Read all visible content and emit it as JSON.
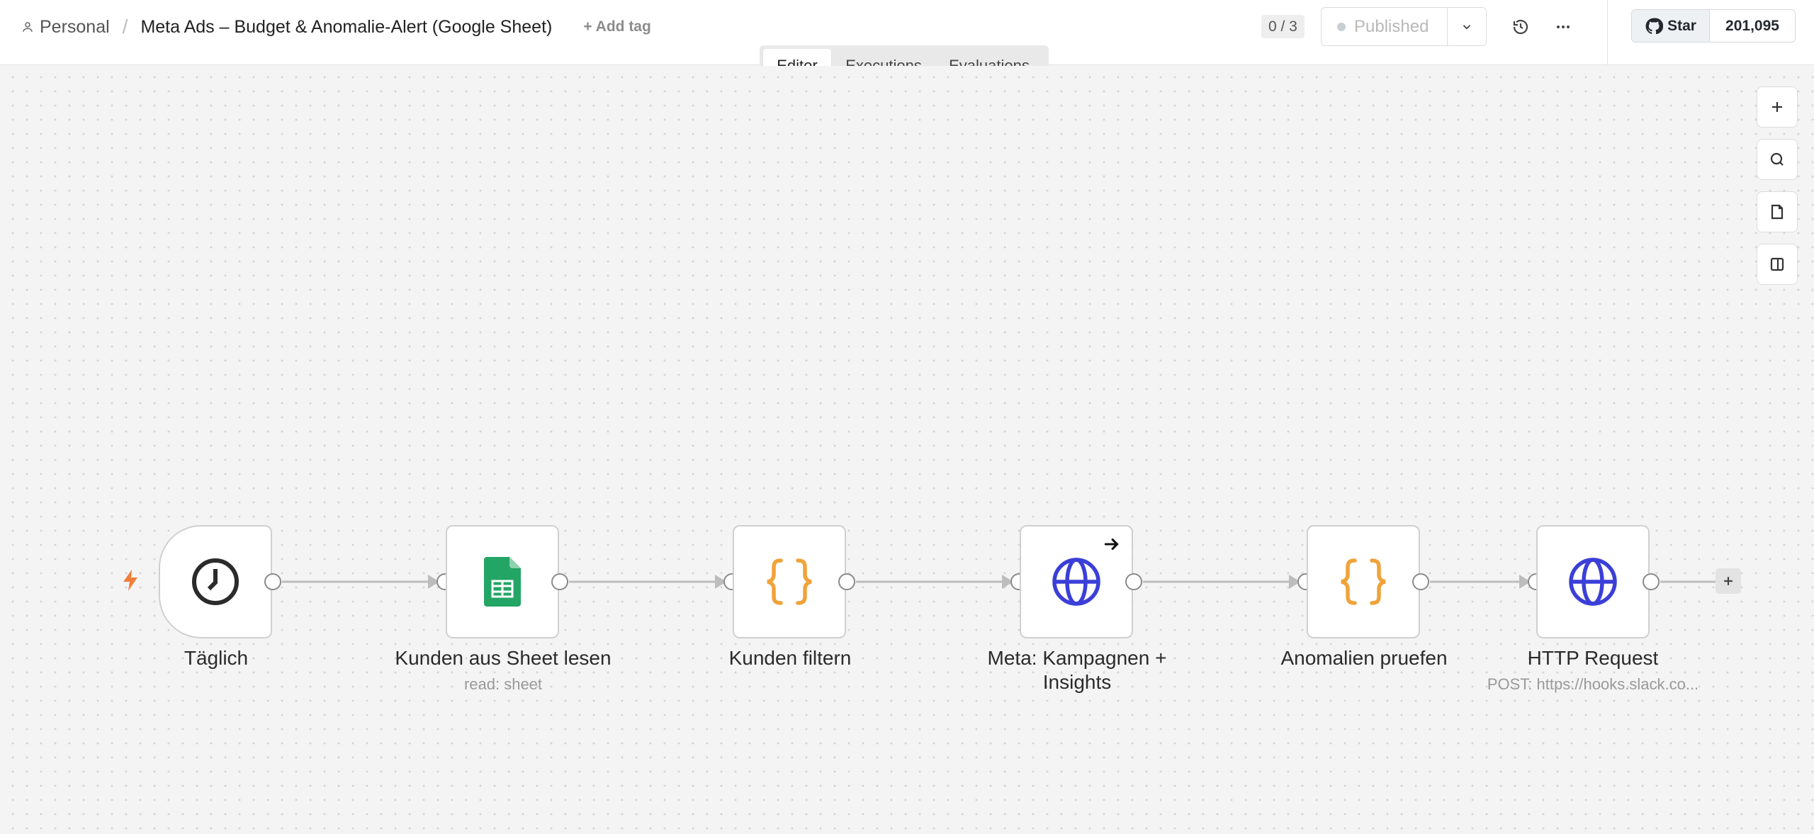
{
  "header": {
    "project": "Personal",
    "separator": "/",
    "workflow_title": "Meta Ads – Budget & Anomalie-Alert (Google Sheet)",
    "add_tag": "+ Add tag",
    "version_counter": "0 / 3",
    "publish_label": "Published",
    "github": {
      "star_label": "Star",
      "star_count": "201,095"
    }
  },
  "tabs": [
    {
      "label": "Editor",
      "active": true
    },
    {
      "label": "Executions",
      "active": false
    },
    {
      "label": "Evaluations",
      "active": false
    }
  ],
  "nodes": [
    {
      "label": "Täglich",
      "subtitle": "",
      "icon": "clock-icon"
    },
    {
      "label": "Kunden aus Sheet lesen",
      "subtitle": "read: sheet",
      "icon": "google-sheets-icon"
    },
    {
      "label": "Kunden filtern",
      "subtitle": "",
      "icon": "code-braces-icon"
    },
    {
      "label_line1": "Meta: Kampagnen +",
      "label_line2": "Insights",
      "subtitle": "",
      "icon": "globe-icon"
    },
    {
      "label": "Anomalien pruefen",
      "subtitle": "",
      "icon": "code-braces-icon"
    },
    {
      "label": "HTTP Request",
      "subtitle": "POST: https://hooks.slack.co...",
      "icon": "globe-icon"
    }
  ],
  "colors": {
    "accent_orange": "#f0a33a",
    "globe_blue": "#3b3fd8",
    "sheets_green": "#23a566",
    "trigger_bolt": "#f07e3a"
  }
}
